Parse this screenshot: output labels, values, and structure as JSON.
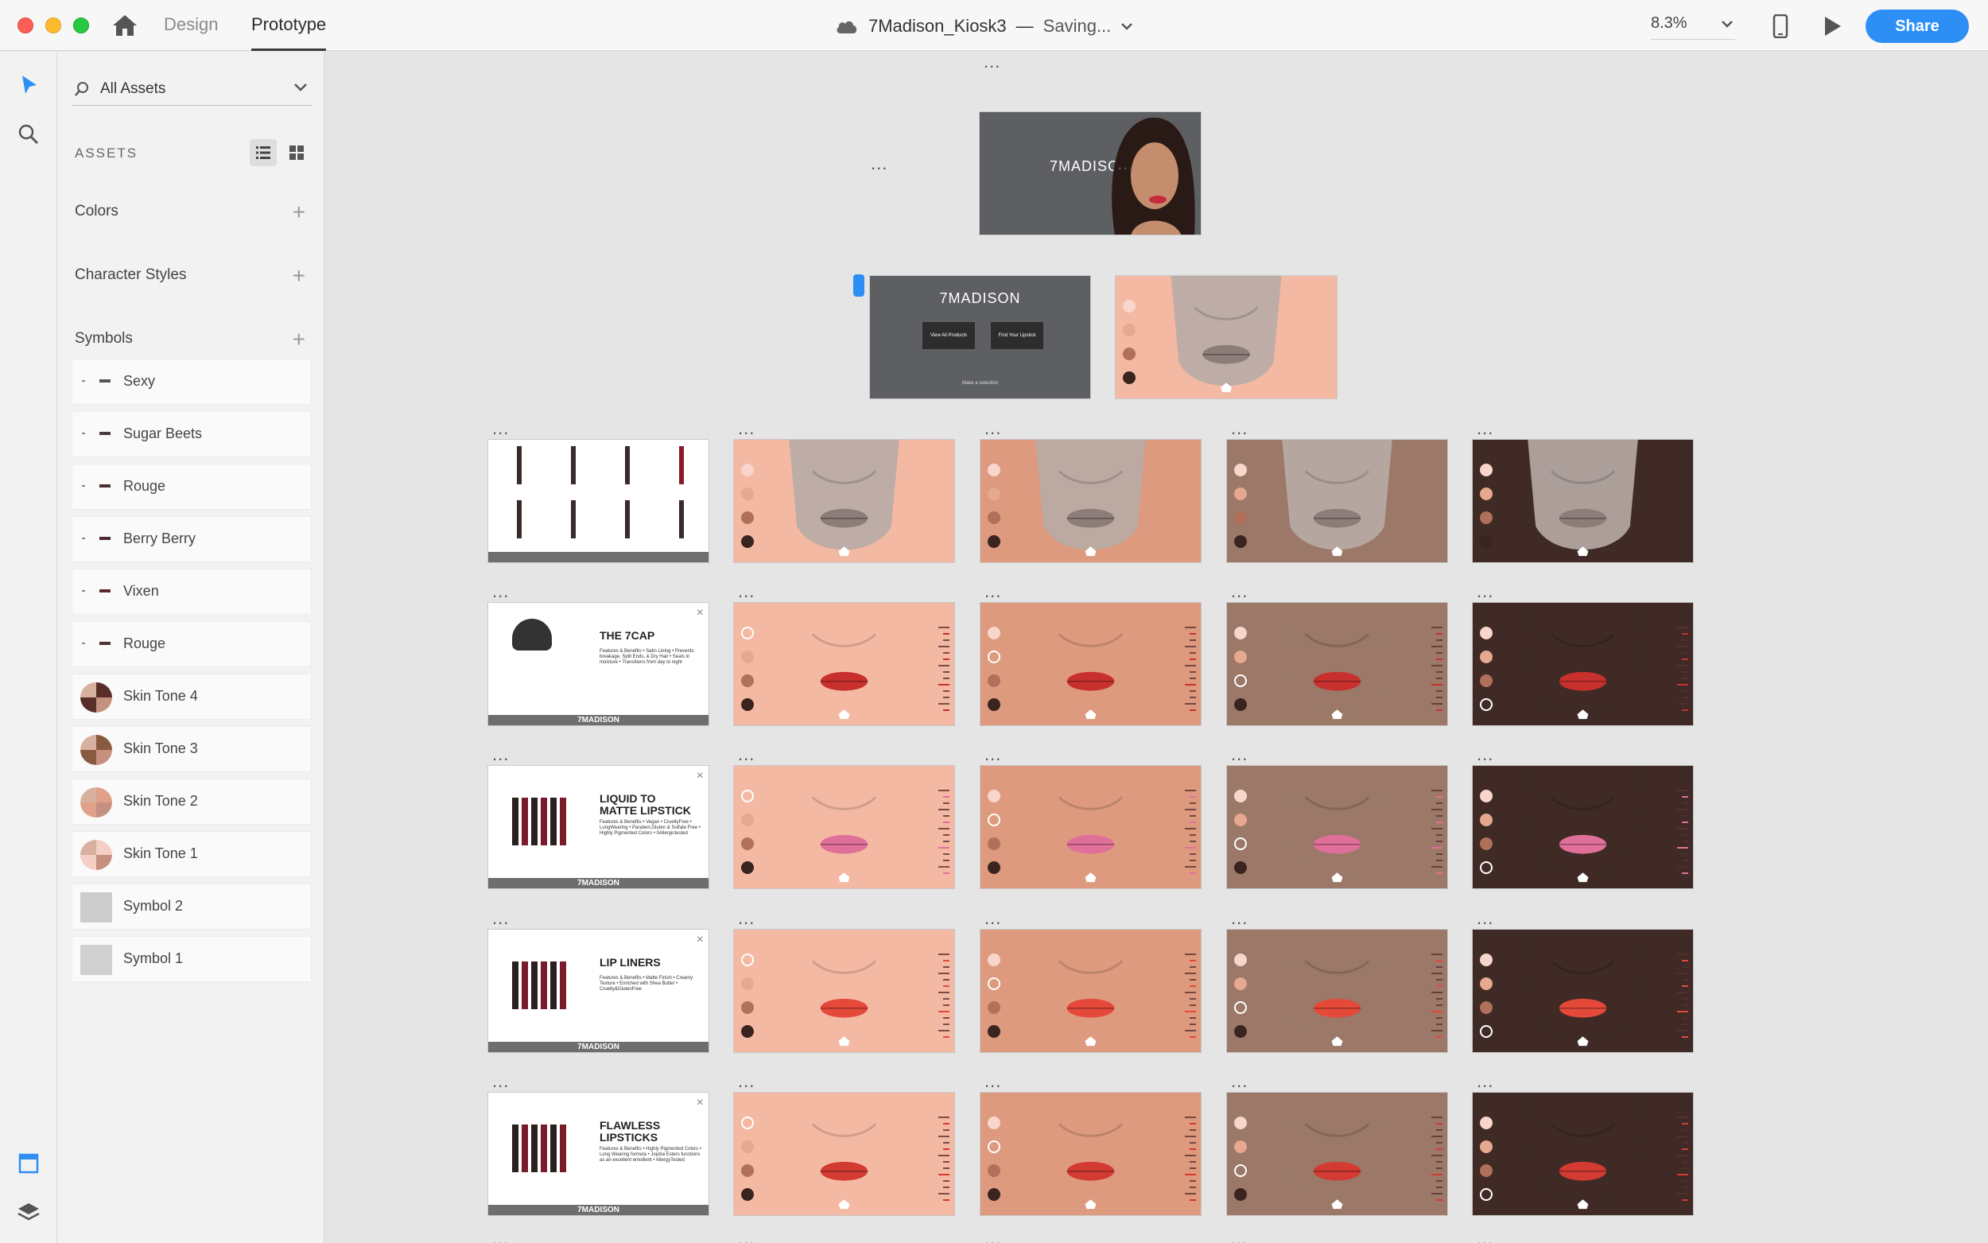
{
  "window": {
    "tabs": {
      "design": "Design",
      "prototype": "Prototype"
    },
    "document_title": "7Madison_Kiosk3",
    "separator": "—",
    "save_status": "Saving...",
    "zoom": "8.3%",
    "share_label": "Share"
  },
  "assets": {
    "search_label": "All Assets",
    "heading": "ASSETS",
    "sections": {
      "colors": "Colors",
      "character_styles": "Character Styles",
      "symbols": "Symbols"
    },
    "symbols": [
      {
        "name": "Sexy",
        "swatch": "#555555"
      },
      {
        "name": "Sugar Beets",
        "swatch": "#4a3a3a"
      },
      {
        "name": "Rouge",
        "swatch": "#4a3030"
      },
      {
        "name": "Berry Berry",
        "swatch": "#4a2a30"
      },
      {
        "name": "Vixen",
        "swatch": "#5a2a2a"
      },
      {
        "name": "Rouge",
        "swatch": "#503030"
      },
      {
        "name": "Skin Tone 4",
        "swatch": "#5a2e28"
      },
      {
        "name": "Skin Tone 3",
        "swatch": "#8a5a40"
      },
      {
        "name": "Skin Tone 2",
        "swatch": "#e0a08a"
      },
      {
        "name": "Skin Tone 1",
        "swatch": "#f4cfc3"
      },
      {
        "name": "Symbol 2",
        "swatch": "#cccccc"
      },
      {
        "name": "Symbol 1",
        "swatch": "#d0d0d0"
      }
    ]
  },
  "canvas": {
    "dots": "...",
    "brand": "7MADISON",
    "menu_buttons": [
      "View All Products",
      "Find Your Lipstick"
    ],
    "menu_hint": "Make a selection",
    "footer_brand": "7MADISON",
    "products": [
      {
        "title": "",
        "body": "",
        "type": "grid"
      },
      {
        "title": "THE 7CAP",
        "body": "Features & Benefits • Satin Lining • Prevents breakage, Split Ends, & Dry Hair • Seals in moisture • Transitions from day to night",
        "type": "card"
      },
      {
        "title": "LIQUID TO MATTE LIPSTICK",
        "body": "Features & Benefits • Vegan • CrueltyFree • LongWearing • Paraben,Gluten & Sulfate Free • Highly Pigmented Colors • 0Allergictested",
        "type": "card"
      },
      {
        "title": "LIP LINERS",
        "body": "Features & Benefits • Matte Finish • Creamy Texture • Enriched with Shea Butter • Cruelty&GlutenFree",
        "type": "card"
      },
      {
        "title": "FLAWLESS LIPSTICKS",
        "body": "Features & Benefits • Highly Pigmented Colors • Long Wearing formula • Jojoba Esters functions as an excellent emollient • AllergyTested",
        "type": "card"
      }
    ],
    "skin_tones": [
      "#f4b9a3",
      "#dd9a7e",
      "#9b7868",
      "#3f2a26"
    ],
    "lip_colors": [
      "#8c7d78",
      "#c8302e",
      "#e0709a",
      "#e4493a",
      "#d23a32"
    ]
  },
  "colors": {
    "accent": "#2d8ff5",
    "canvas": "#e5e5e5",
    "panel": "#f2f2f2"
  }
}
